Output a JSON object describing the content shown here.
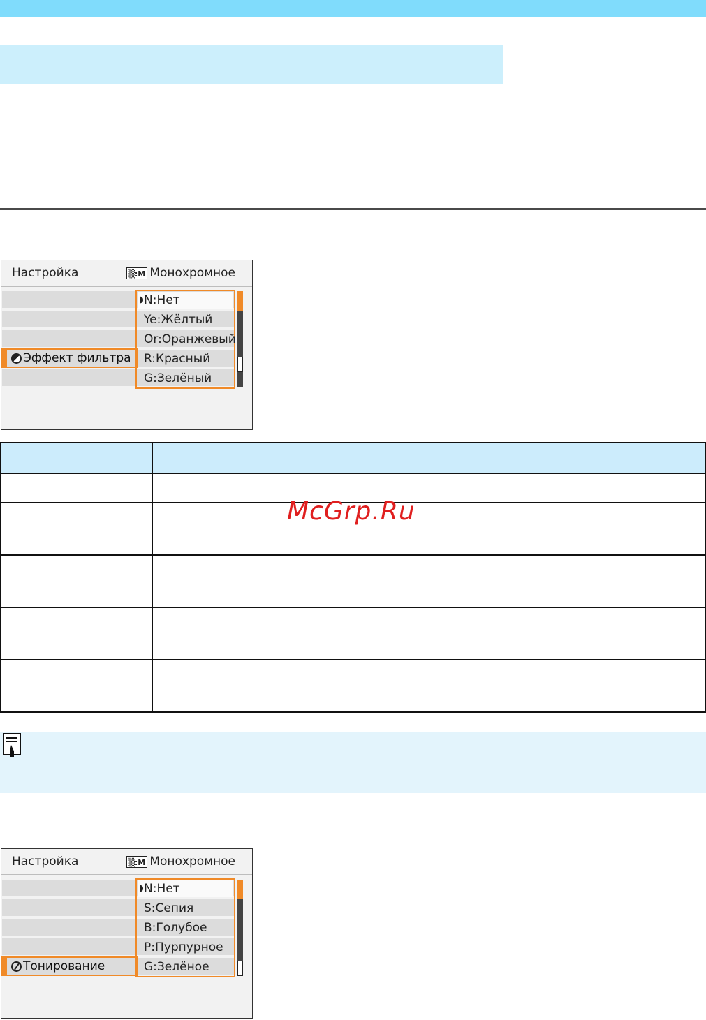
{
  "watermark": "McGrp.Ru",
  "screen_filter": {
    "header_left": "Настройка",
    "mode_icon_label": "▒:M",
    "header_right": "Монохромное",
    "options": [
      "N:Нет",
      "Ye:Жёлтый",
      "Or:Оранжевый",
      "R:Красный",
      "G:Зелёный"
    ],
    "selected_index": 0,
    "setting_label": "Эффект фильтра",
    "icon": "filter-effect-icon"
  },
  "screen_toning": {
    "header_left": "Настройка",
    "mode_icon_label": "▒:M",
    "header_right": "Монохромное",
    "options": [
      "N:Нет",
      "S:Сепия",
      "B:Голубое",
      "P:Пурпурное",
      "G:Зелёное"
    ],
    "selected_index": 0,
    "setting_label": "Тонирование",
    "icon": "toning-icon"
  },
  "note": {
    "icon": "memo-pencil-icon"
  },
  "colors": {
    "accent": "#f08a28",
    "top_band": "#80dcfc",
    "heading_band": "#cceffc",
    "table_header": "#ccecfc",
    "note_band": "#e3f4fc"
  }
}
